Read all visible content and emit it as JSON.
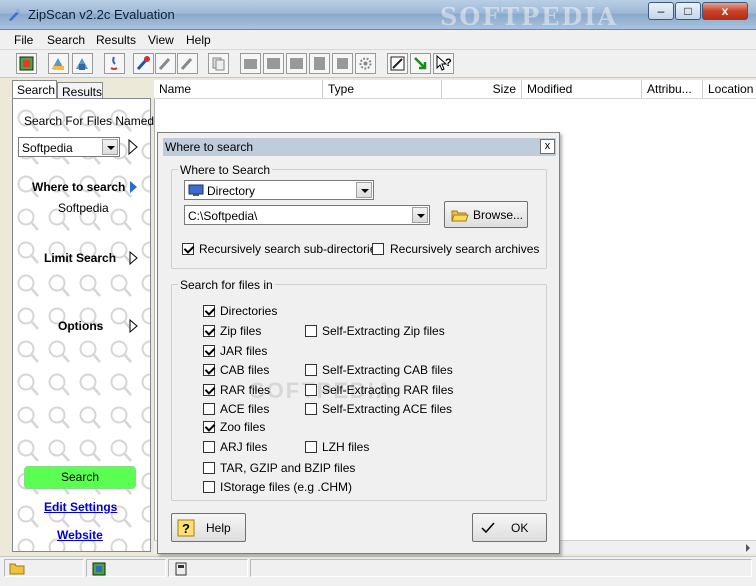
{
  "window": {
    "title": "ZipScan v2.2c Evaluation",
    "watermark": "SOFTPEDIA",
    "minimize": "–",
    "maximize": "□",
    "close": "x"
  },
  "menu": [
    "File",
    "Search",
    "Results",
    "View",
    "Help"
  ],
  "left_pane": {
    "tabs": [
      "Search",
      "Results"
    ],
    "search_named_label": "Search For Files Named",
    "search_named_value": "Softpedia",
    "where_label": "Where to search",
    "where_value": "Softpedia",
    "limit_label": "Limit Search",
    "options_label": "Options",
    "search_button": "Search",
    "edit_settings": "Edit Settings",
    "website": "Website"
  },
  "list_columns": [
    "Name",
    "Type",
    "Size",
    "Modified",
    "Attribu...",
    "Location"
  ],
  "dialog": {
    "title": "Where to search",
    "close": "x",
    "where_group": "Where to Search",
    "location_type": "Directory",
    "path": "C:\\Softpedia\\",
    "browse": "Browse...",
    "recurse_dirs": {
      "label": "Recursively search sub-directories",
      "checked": true
    },
    "recurse_archives": {
      "label": "Recursively search archives",
      "checked": false
    },
    "files_group": "Search for files in",
    "file_types": [
      {
        "label": "Directories",
        "checked": true
      },
      {
        "label": "Zip files",
        "checked": true
      },
      {
        "label": "JAR files",
        "checked": true
      },
      {
        "label": "CAB files",
        "checked": true
      },
      {
        "label": "RAR files",
        "checked": true
      },
      {
        "label": "ACE files",
        "checked": false
      },
      {
        "label": "Zoo files",
        "checked": true
      },
      {
        "label": "ARJ files",
        "checked": false
      },
      {
        "label": "TAR, GZIP and BZIP files",
        "checked": false
      },
      {
        "label": "IStorage files (e.g .CHM)",
        "checked": false
      }
    ],
    "extra_types": [
      {
        "label": "Self-Extracting Zip files",
        "checked": false
      },
      {
        "label": "Self-Extracting CAB files",
        "checked": false
      },
      {
        "label": "Self-Extracting RAR files",
        "checked": false
      },
      {
        "label": "Self-Extracting ACE files",
        "checked": false
      },
      {
        "label": "LZH files",
        "checked": false
      }
    ],
    "help_button": "Help",
    "ok_button": "OK"
  }
}
